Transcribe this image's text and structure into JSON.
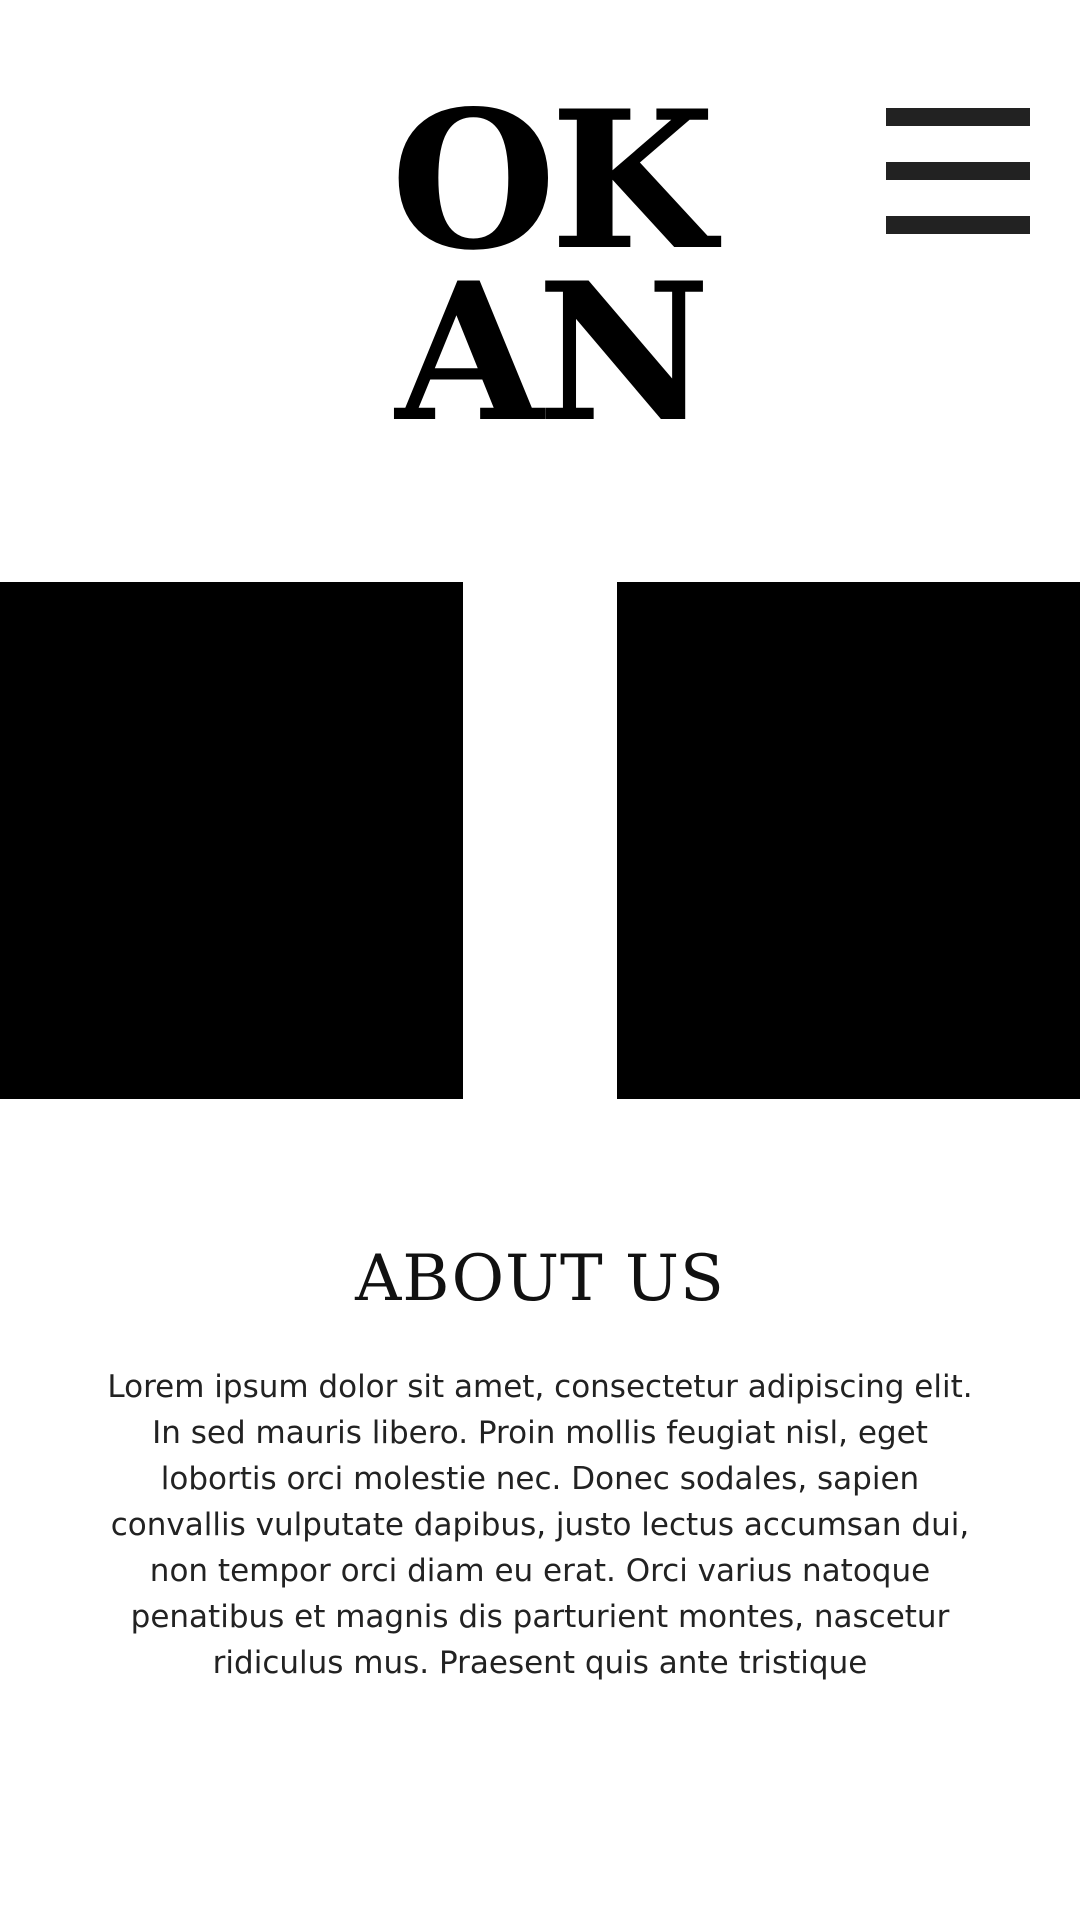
{
  "logo": {
    "line1": "OK",
    "line2": "AN"
  },
  "menu": {
    "icon": "hamburger-menu-icon"
  },
  "about": {
    "title": "ABOUT US",
    "body": "Lorem ipsum dolor sit amet, consectetur adipiscing elit. In sed mauris libero. Proin mollis feugiat nisl, eget lobortis orci molestie nec. Donec sodales, sapien convallis vulputate dapibus, justo lectus accumsan dui, non tempor orci diam eu erat. Orci varius natoque penatibus et magnis dis parturient montes, nascetur ridiculus mus. Praesent quis ante tristique"
  },
  "colors": {
    "background": "#ffffff",
    "text": "#000000",
    "menu_bars": "#222222",
    "image_blocks": "#000000"
  }
}
